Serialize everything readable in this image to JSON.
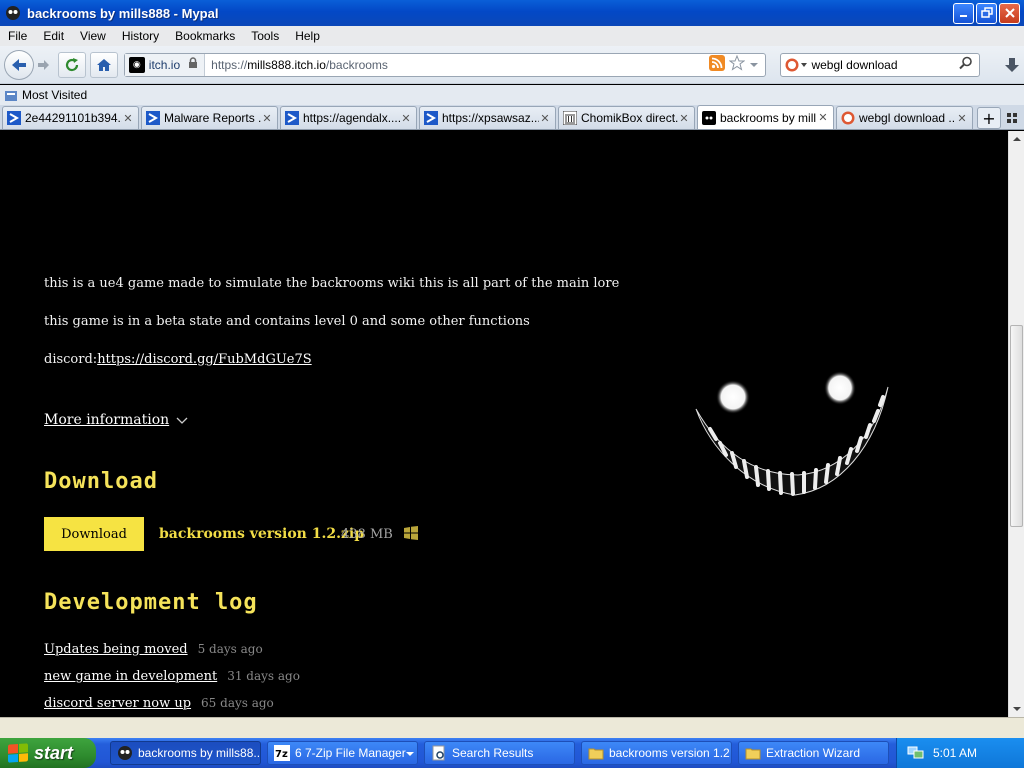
{
  "window": {
    "title": "backrooms by mills888 - Mypal"
  },
  "menu": [
    "File",
    "Edit",
    "View",
    "History",
    "Bookmarks",
    "Tools",
    "Help"
  ],
  "navbar": {
    "identity_label": "itch.io",
    "url_prefix": "https://",
    "url_domain": "mills888.itch.io",
    "url_path": "/backrooms",
    "search_value": "webgl download"
  },
  "bookmarks": {
    "most_visited": "Most Visited"
  },
  "tabs": [
    {
      "label": "2e44291101b394...",
      "icon": "virustotal-icon"
    },
    {
      "label": "Malware Reports ...",
      "icon": "virustotal-icon"
    },
    {
      "label": "https://agendalx....",
      "icon": "virustotal-icon"
    },
    {
      "label": "https://xpsawsaz...",
      "icon": "virustotal-icon"
    },
    {
      "label": "ChomikBox direct...",
      "icon": "building-icon"
    },
    {
      "label": "backrooms by mill...",
      "icon": "itchio-icon",
      "active": true
    },
    {
      "label": "webgl download ...",
      "icon": "duckduckgo-icon"
    }
  ],
  "content": {
    "desc1": "this is a ue4 game made to simulate the backrooms wiki this is all part of the main lore",
    "desc2": "this game is in a beta state and contains level 0 and some other functions",
    "discord_label": "discord:",
    "discord_link": "https://discord.gg/FubMdGUe7S",
    "more_info": "More information",
    "download_heading": "Download",
    "download_button": "Download",
    "file_name": "backrooms version 1.2.zip",
    "file_size": "438 MB",
    "devlog_heading": "Development log",
    "devlog": [
      {
        "title": "Updates being moved",
        "time": "5 days ago"
      },
      {
        "title": "new game in development",
        "time": "31 days ago"
      },
      {
        "title": "discord server now up",
        "time": "65 days ago"
      }
    ]
  },
  "taskbar": {
    "start": "start",
    "tasks": [
      {
        "label": "backrooms by mills88...",
        "active": true
      },
      {
        "label": "6 7-Zip File Manager"
      },
      {
        "label": "Search Results"
      },
      {
        "label": "backrooms version 1.2"
      },
      {
        "label": "Extraction Wizard"
      }
    ],
    "clock": "5:01 AM"
  },
  "colors": {
    "accent_yellow": "#f6e342",
    "titlebar_blue": "#0a5fd8",
    "start_green": "#3ea43e"
  }
}
